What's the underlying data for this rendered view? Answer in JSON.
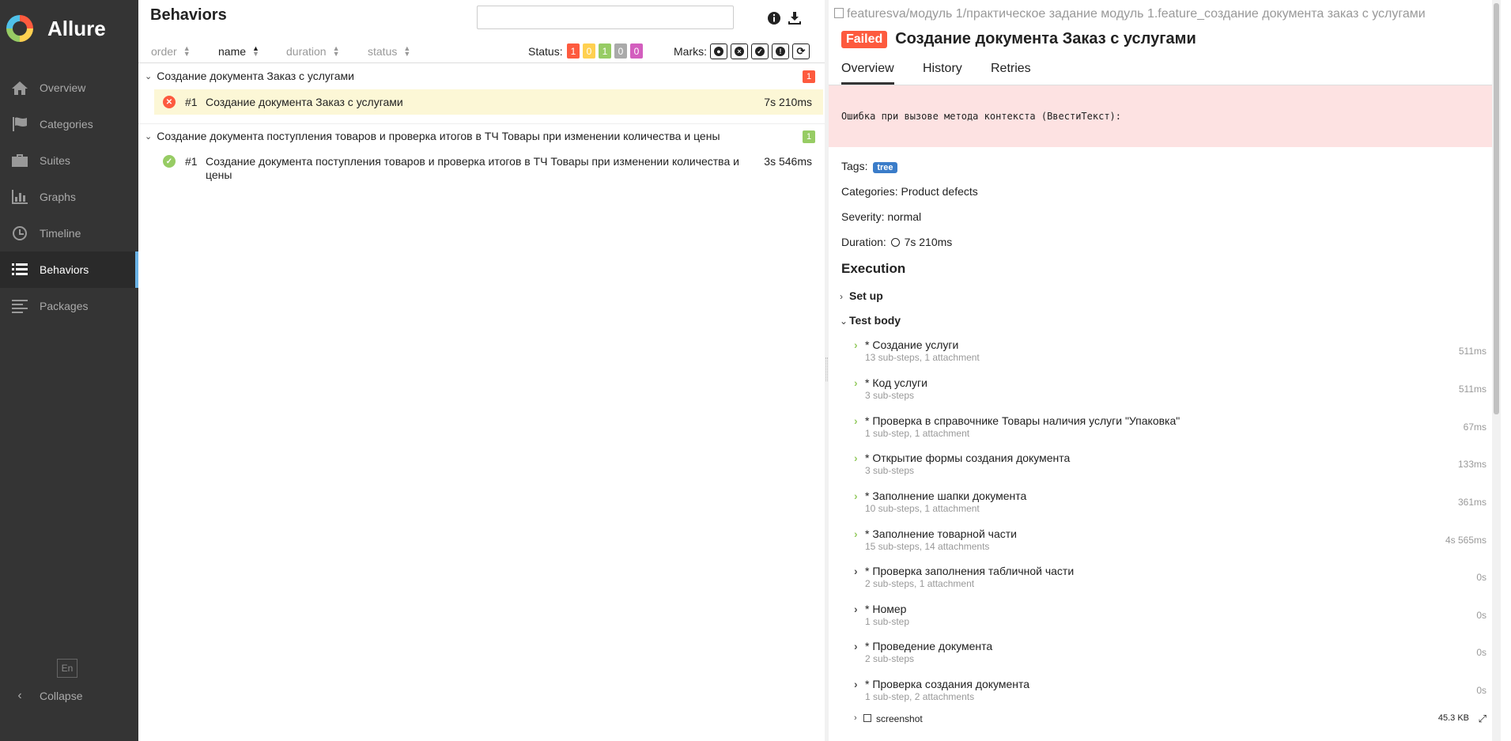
{
  "sidebar": {
    "brand": "Allure",
    "items": [
      {
        "label": "Overview",
        "icon": "home-icon"
      },
      {
        "label": "Categories",
        "icon": "flag-icon"
      },
      {
        "label": "Suites",
        "icon": "briefcase-icon"
      },
      {
        "label": "Graphs",
        "icon": "bar-chart-icon"
      },
      {
        "label": "Timeline",
        "icon": "clock-icon"
      },
      {
        "label": "Behaviors",
        "icon": "list-icon",
        "active": true
      },
      {
        "label": "Packages",
        "icon": "align-left-icon"
      }
    ],
    "language": "En",
    "collapse": "Collapse"
  },
  "middle": {
    "title": "Behaviors",
    "search_value": "",
    "sort": {
      "order": "order",
      "name": "name",
      "duration": "duration",
      "status": "status"
    },
    "status_label": "Status:",
    "status_counts": [
      {
        "value": "1",
        "color": "#fd5a3e",
        "kind": "failed"
      },
      {
        "value": "0",
        "color": "#ffd050",
        "kind": "broken"
      },
      {
        "value": "1",
        "color": "#97cc64",
        "kind": "passed"
      },
      {
        "value": "0",
        "color": "#aaaaaa",
        "kind": "skipped"
      },
      {
        "value": "0",
        "color": "#d35ebe",
        "kind": "unknown"
      }
    ],
    "marks_label": "Marks:",
    "groups": [
      {
        "name": "Создание документа Заказ с услугами",
        "count": "1",
        "count_color": "#fd5a3e",
        "rows": [
          {
            "status": "failed",
            "num": "#1",
            "name": "Создание документа Заказ с услугами",
            "duration": "7s 210ms"
          }
        ]
      },
      {
        "name": "Создание документа поступления товаров и проверка итогов в ТЧ Товары при изменении количества и цены",
        "count": "1",
        "count_color": "#97cc64",
        "rows": [
          {
            "status": "passed",
            "num": "#1",
            "name": "Создание документа поступления товаров и проверка итогов в ТЧ Товары при изменении количества и цены",
            "duration": "3s 546ms"
          }
        ]
      }
    ]
  },
  "detail": {
    "breadcrumb": "featuresva/модуль 1/практическое задание модуль 1.feature_создание документа заказ с услугами",
    "status": "Failed",
    "title": "Создание документа Заказ с услугами",
    "tabs": [
      "Overview",
      "History",
      "Retries"
    ],
    "error": "Ошибка при вызове метода контекста (ВвестиТекст):",
    "tags_label": "Tags:",
    "tag": "tree",
    "categories": "Categories: Product defects",
    "severity": "Severity: normal",
    "duration_label": "Duration:",
    "duration": "7s 210ms",
    "execution": "Execution",
    "setup": "Set up",
    "test_body": "Test body",
    "steps": [
      {
        "name": "* Создание услуги",
        "sub": "13 sub-steps, 1 attachment",
        "duration": "511ms",
        "color": "#97cc64"
      },
      {
        "name": "* Код услуги",
        "sub": "3 sub-steps",
        "duration": "511ms",
        "color": "#97cc64"
      },
      {
        "name": "* Проверка в справочнике Товары наличия услуги \"Упаковка\"",
        "sub": "1 sub-step, 1 attachment",
        "duration": "67ms",
        "color": "#97cc64"
      },
      {
        "name": "* Открытие формы создания документа",
        "sub": "3 sub-steps",
        "duration": "133ms",
        "color": "#97cc64"
      },
      {
        "name": "* Заполнение шапки документа",
        "sub": "10 sub-steps, 1 attachment",
        "duration": "361ms",
        "color": "#97cc64"
      },
      {
        "name": "* Заполнение товарной части",
        "sub": "15 sub-steps, 14 attachments",
        "duration": "4s 565ms",
        "color": "#97cc64"
      },
      {
        "name": "* Проверка заполнения табличной части",
        "sub": "2 sub-steps, 1 attachment",
        "duration": "0s",
        "color": "#555555"
      },
      {
        "name": "* Номер",
        "sub": "1 sub-step",
        "duration": "0s",
        "color": "#555555"
      },
      {
        "name": "* Проведение документа",
        "sub": "2 sub-steps",
        "duration": "0s",
        "color": "#555555"
      },
      {
        "name": "* Проверка создания документа",
        "sub": "1 sub-step, 2 attachments",
        "duration": "0s",
        "color": "#555555"
      }
    ],
    "attachment": {
      "name": "screenshot",
      "size": "45.3 KB"
    }
  }
}
